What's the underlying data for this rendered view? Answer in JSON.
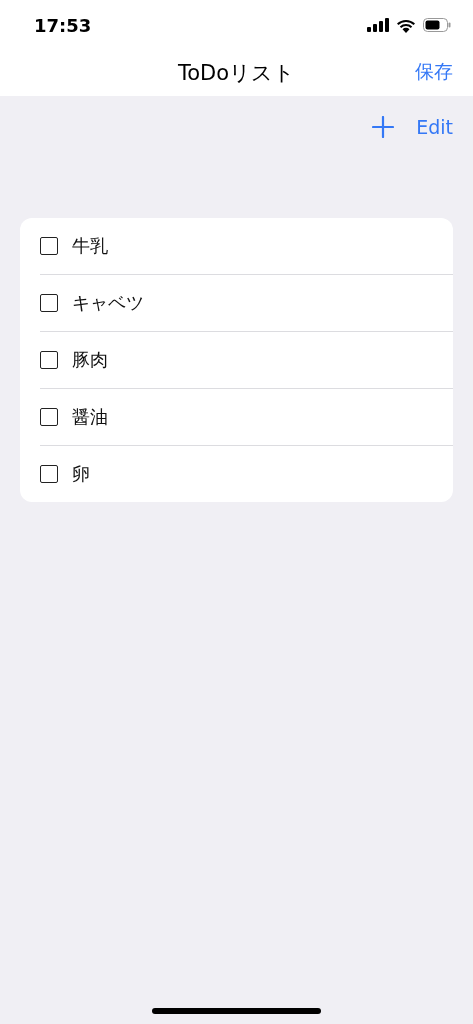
{
  "status_bar": {
    "time": "17:53"
  },
  "nav_bar": {
    "title": "ToDoリスト",
    "right_button": "保存"
  },
  "toolbar": {
    "edit_button": "Edit"
  },
  "items": [
    {
      "label": "牛乳",
      "checked": false
    },
    {
      "label": "キャベツ",
      "checked": false
    },
    {
      "label": "豚肉",
      "checked": false
    },
    {
      "label": "醤油",
      "checked": false
    },
    {
      "label": "卵",
      "checked": false
    }
  ]
}
